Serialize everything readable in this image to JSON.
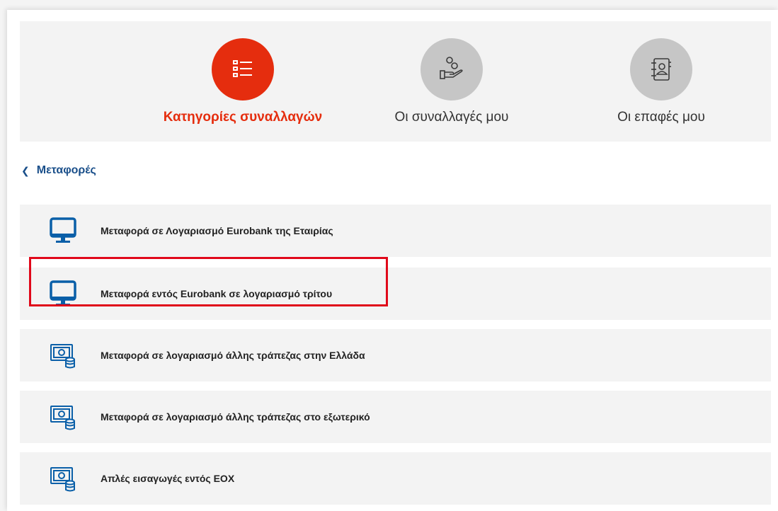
{
  "tabs": [
    {
      "label": "Κατηγορίες συναλλαγών",
      "icon": "list-icon",
      "active": true
    },
    {
      "label": "Οι συναλλαγές μου",
      "icon": "coins-hand-icon",
      "active": false
    },
    {
      "label": "Οι επαφές μου",
      "icon": "contacts-book-icon",
      "active": false
    }
  ],
  "breadcrumb": {
    "back_icon": "chevron-left-icon",
    "label": "Μεταφορές"
  },
  "items": [
    {
      "label": "Μεταφορά σε Λογαριασμό Eurobank της Εταιρίας",
      "icon": "monitor-icon"
    },
    {
      "label": "Μεταφορά εντός Eurobank σε λογαριασμό τρίτου",
      "icon": "monitor-icon",
      "highlighted": true
    },
    {
      "label": "Μεταφορά σε λογαριασμό άλλης τράπεζας στην Ελλάδα",
      "icon": "banknote-coins-icon"
    },
    {
      "label": "Μεταφορά σε λογαριασμό άλλης τράπεζας στο εξωτερικό",
      "icon": "banknote-coins-icon"
    },
    {
      "label": "Απλές εισαγωγές εντός ΕΟΧ",
      "icon": "banknote-coins-icon"
    }
  ],
  "colors": {
    "accent": "#e52d0e",
    "link": "#1a4f8a",
    "icon_blue": "#0a5fa8",
    "highlight": "#e0081a",
    "tab_grey": "#c6c6c6"
  }
}
